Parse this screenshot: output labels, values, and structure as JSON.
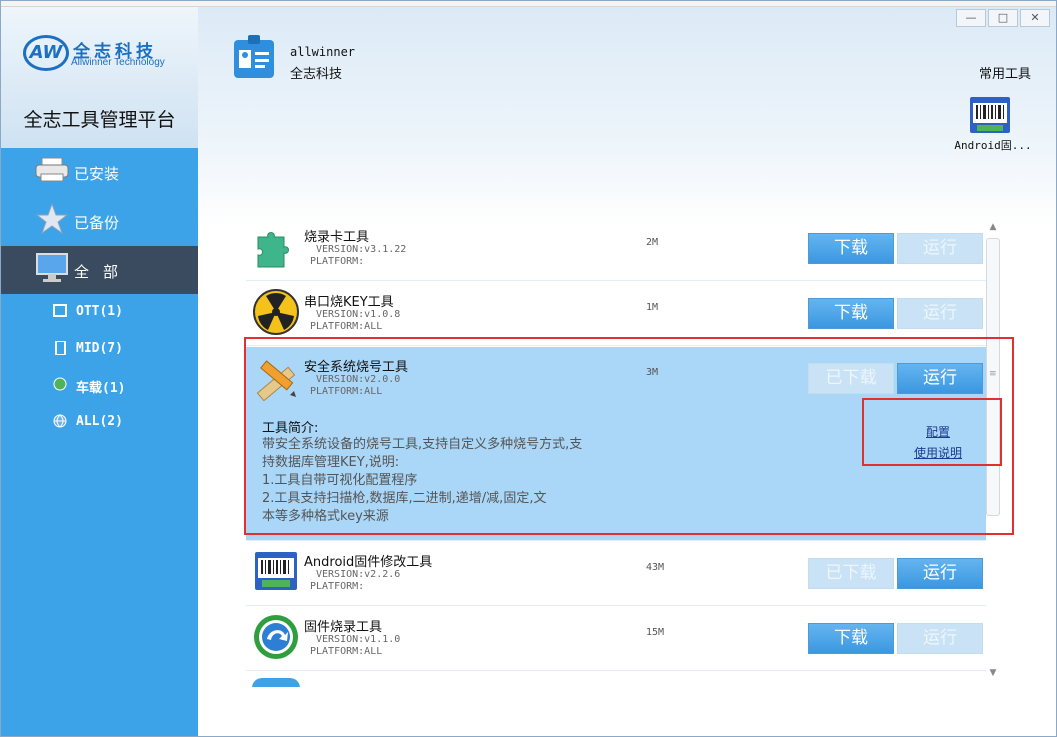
{
  "sidebar": {
    "logo_mark": "AW",
    "logo_cn": "全志科技",
    "logo_en": "Allwinner Technology",
    "platform_title": "全志工具管理平台",
    "nav": [
      {
        "label": "已安装",
        "icon": "printer-icon"
      },
      {
        "label": "已备份",
        "icon": "star-icon"
      },
      {
        "label": "全部",
        "icon": "monitor-icon",
        "active": true
      }
    ],
    "sub": [
      {
        "label": "OTT(1)",
        "icon": "tv-icon"
      },
      {
        "label": "MID(7)",
        "icon": "tablet-icon"
      },
      {
        "label": "车载(1)",
        "icon": "car-icon"
      },
      {
        "label": "ALL(2)",
        "icon": "globe-icon"
      }
    ]
  },
  "header": {
    "company_en": "allwinner",
    "company_cn": "全志科技",
    "common_tools_label": "常用工具",
    "quick_tool_label": "Android固...",
    "window_buttons": [
      "—",
      "□",
      "✕"
    ]
  },
  "tools": [
    {
      "name": "烧录卡工具",
      "version": "VERSION:v3.1.22",
      "platform": "PLATFORM:",
      "size": "2M",
      "btn1": "下载",
      "btn1_enabled": true,
      "btn2": "运行",
      "btn2_enabled": false
    },
    {
      "name": "串口烧KEY工具",
      "version": "VERSION:v1.0.8",
      "platform": "PLATFORM:ALL",
      "size": "1M",
      "btn1": "下载",
      "btn1_enabled": true,
      "btn2": "运行",
      "btn2_enabled": false
    },
    {
      "name": "安全系统烧号工具",
      "version": "VERSION:v2.0.0",
      "platform": "PLATFORM:ALL",
      "size": "3M",
      "btn1": "已下载",
      "btn1_enabled": false,
      "btn2": "运行",
      "btn2_enabled": true,
      "desc_title": "工具简介:",
      "desc_lines": [
        "带安全系统设备的烧号工具,支持自定义多种烧号方式,支",
        "持数据库管理KEY,说明:",
        "1.工具自带可视化配置程序",
        "2.工具支持扫描枪,数据库,二进制,递增/减,固定,文",
        "本等多种格式key来源"
      ],
      "link_config": "配置",
      "link_manual": "使用说明"
    },
    {
      "name": "Android固件修改工具",
      "version": "VERSION:v2.2.6",
      "platform": "PLATFORM:",
      "size": "43M",
      "btn1": "已下载",
      "btn1_enabled": false,
      "btn2": "运行",
      "btn2_enabled": true
    },
    {
      "name": "固件烧录工具",
      "version": "VERSION:v1.1.0",
      "platform": "PLATFORM:ALL",
      "size": "15M",
      "btn1": "下载",
      "btn1_enabled": true,
      "btn2": "运行",
      "btn2_enabled": false
    }
  ]
}
